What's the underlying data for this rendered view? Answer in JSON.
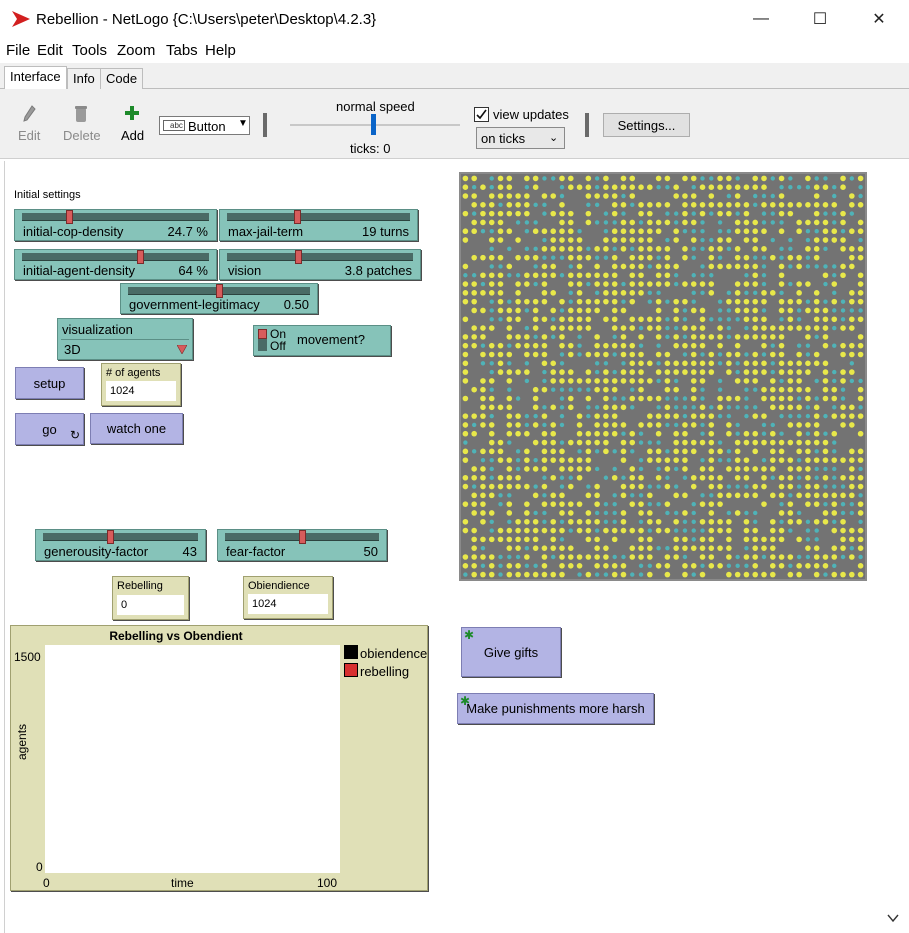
{
  "window": {
    "title": "Rebellion - NetLogo {C:\\Users\\peter\\Desktop\\4.2.3}",
    "minimize": "—",
    "maximize": "☐",
    "close": "✕"
  },
  "menu": [
    "File",
    "Edit",
    "Tools",
    "Zoom",
    "Tabs",
    "Help"
  ],
  "tabs": [
    "Interface",
    "Info",
    "Code"
  ],
  "toolbar": {
    "edit_label": "Edit",
    "delete_label": "Delete",
    "add_label": "Add",
    "widget_type": "Button",
    "widget_type_icon": "abc",
    "speed_label": "normal speed",
    "ticks_label": "ticks: 0",
    "view_updates_label": "view updates",
    "view_updates_checked": true,
    "update_mode": "on ticks",
    "settings_label": "Settings..."
  },
  "widgets": {
    "initial_settings_note": "Initial settings",
    "sliders": {
      "initial_cop_density": {
        "label": "initial-cop-density",
        "value": "24.7 %",
        "fraction": 0.247
      },
      "max_jail_term": {
        "label": "max-jail-term",
        "value": "19 turns",
        "fraction": 0.38
      },
      "initial_agent_density": {
        "label": "initial-agent-density",
        "value": "64 %",
        "fraction": 0.64
      },
      "vision": {
        "label": "vision",
        "value": "3.8 patches",
        "fraction": 0.38
      },
      "government_legitimacy": {
        "label": "government-legitimacy",
        "value": "0.50",
        "fraction": 0.5
      },
      "generousity_factor": {
        "label": "generousity-factor",
        "value": "43",
        "fraction": 0.43
      },
      "fear_factor": {
        "label": "fear-factor",
        "value": "50",
        "fraction": 0.5
      }
    },
    "chooser": {
      "label": "visualization",
      "value": "3D"
    },
    "switch": {
      "on_label": "On",
      "off_label": "Off",
      "name": "movement?",
      "state": "off"
    },
    "buttons": {
      "setup": "setup",
      "go": "go",
      "watch_one": "watch one",
      "give_gifts": "Give gifts",
      "harsh": "Make punishments more harsh"
    },
    "monitors": {
      "agents": {
        "label": "# of agents",
        "value": "1024"
      },
      "rebelling": {
        "label": "Rebelling",
        "value": "0"
      },
      "obedience": {
        "label": "Obiendience",
        "value": "1024"
      }
    }
  },
  "plot": {
    "title": "Rebelling vs Obendient",
    "legend": [
      {
        "name": "obiendence",
        "color": "#000000"
      },
      {
        "name": "rebelling",
        "color": "#d73030"
      }
    ],
    "ymax_label": "1500",
    "ymin_label": "0",
    "xmin_label": "0",
    "xmax_label": "100",
    "xlabel": "time",
    "ylabel": "agents"
  },
  "colors": {
    "slider": "#86c3b9",
    "button": "#b3b4e4",
    "monitor": "#e0e0b7",
    "view_bg": "#737373",
    "agent_yellow": "#e8e84a",
    "cop_cyan": "#4fb3b8"
  }
}
